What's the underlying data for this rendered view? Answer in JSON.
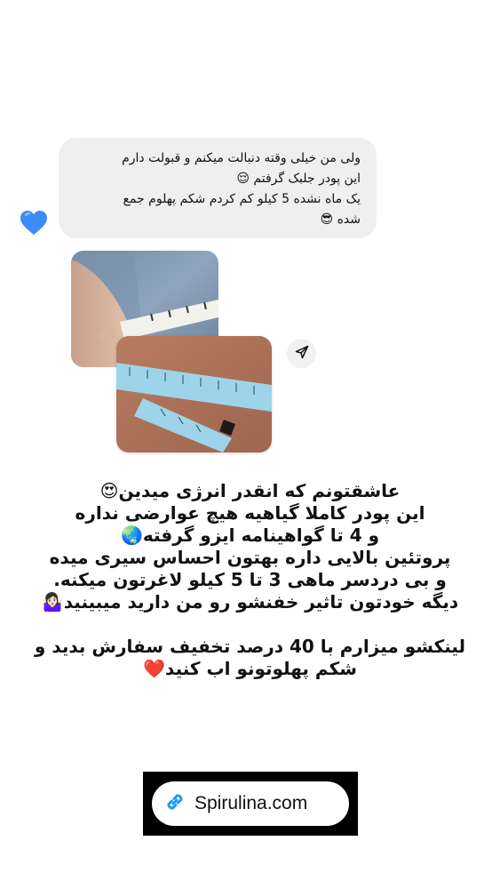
{
  "message": {
    "lines": [
      "ولی من خیلی وقته دنبالت میکنم و قبولت دارم",
      "این پودر جلبک گرفتم 😌",
      "یک ماه نشده 5 کیلو کم کردم شکم پهلوم جمع",
      "شده 😎"
    ]
  },
  "reaction": {
    "icon": "blue-heart"
  },
  "photos": [
    {
      "alt": "measuring tape around waist on jeans"
    },
    {
      "alt": "measuring tape on fabric"
    }
  ],
  "share": {
    "icon": "send-icon"
  },
  "caption": {
    "block1": [
      "عاشقتونم که انقدر انرژی میدین😍",
      "این پودر کاملا گیاهیه هیچ عوارضی نداره",
      "و 4 تا گواهینامه ایزو گرفته🌏",
      "پروتئین بالایی داره بهتون احساس سیری میده",
      "و بی دردسر ماهی 3 تا 5 کیلو لاغرتون میکنه.",
      "دیگه خودتون تاثیر خفنشو رو من دارید میبینید🤷🏻‍♀️"
    ],
    "block2": [
      "لینکشو میزارم با 40 درصد تخفیف سفارش بدید و",
      "شکم پهلوتونو اب کنید❤️"
    ]
  },
  "link_sticker": {
    "text": "Spirulina.com",
    "icon": "link-icon"
  },
  "colors": {
    "accent": "#1d9bf0",
    "heart": "#2d8cf0",
    "bubble": "#efefef"
  }
}
